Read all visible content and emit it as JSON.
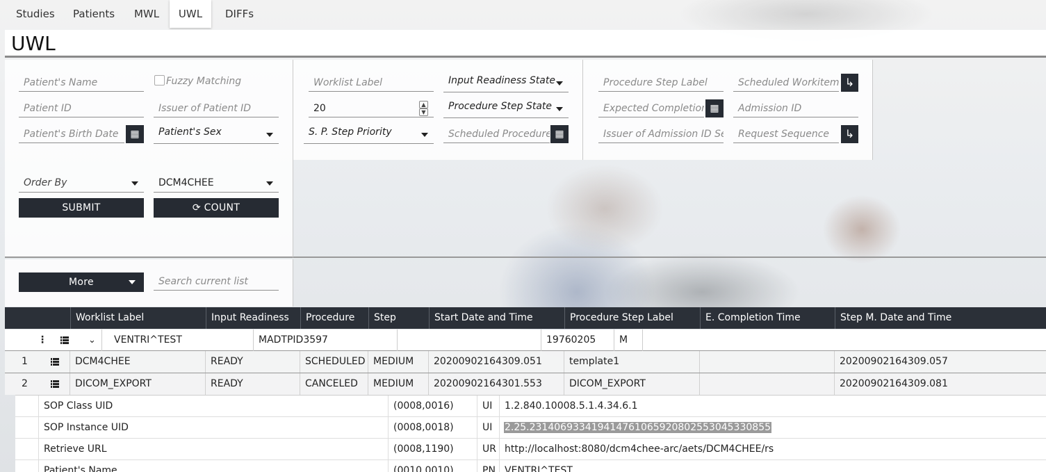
{
  "nav": {
    "tabs": [
      "Studies",
      "Patients",
      "MWL",
      "UWL",
      "DIFFs"
    ],
    "active": "UWL"
  },
  "page": {
    "title": "UWL"
  },
  "filters": {
    "patients_name": "Patient's Name",
    "fuzzy_matching": "Fuzzy Matching",
    "patient_id": "Patient ID",
    "issuer_of_patient_id": "Issuer of Patient ID",
    "patients_birth_date": "Patient's Birth Date",
    "patients_sex": "Patient's Sex",
    "worklist_label": "Worklist Label",
    "input_readiness_state": "Input Readiness State",
    "limit_value": "20",
    "procedure_step_state": "Procedure Step State",
    "sp_step_priority": "S. P. Step Priority",
    "scheduled_procedure_start": "Scheduled Procedure S",
    "procedure_step_label": "Procedure Step Label",
    "scheduled_workitem": "Scheduled Workitem",
    "expected_completion": "Expected Completion D",
    "admission_id": "Admission ID",
    "issuer_of_admission_id": "Issuer of Admission ID Sequ",
    "request_sequence": "Request Sequence",
    "order_by": "Order By",
    "aet": "DCM4CHEE",
    "submit": "SUBMIT",
    "count": "COUNT",
    "more": "More",
    "search_current_list": "Search current list"
  },
  "table": {
    "headers": [
      "Worklist Label",
      "Input Readiness",
      "Procedure",
      "Step",
      "Start Date and Time",
      "Procedure Step Label",
      "E. Completion Time",
      "Step M. Date and Time"
    ],
    "patient_row": {
      "name": "VENTRI^TEST",
      "id": "MADTPID3597",
      "birth_date": "19760205",
      "sex": "M"
    },
    "rows": [
      {
        "num": "1",
        "worklist": "DCM4CHEE",
        "readiness": "READY",
        "procedure": "SCHEDULED",
        "step": "MEDIUM",
        "start": "20200902164309.051",
        "label": "template1",
        "completion": "",
        "modified": "20200902164309.057"
      },
      {
        "num": "2",
        "worklist": "DICOM_EXPORT",
        "readiness": "READY",
        "procedure": "CANCELED",
        "step": "MEDIUM",
        "start": "20200902164301.553",
        "label": "DICOM_EXPORT",
        "completion": "",
        "modified": "20200902164309.081"
      }
    ]
  },
  "attributes": [
    {
      "name": "SOP Class UID",
      "tag": "(0008,0016)",
      "vr": "UI",
      "value": "1.2.840.10008.5.1.4.34.6.1"
    },
    {
      "name": "SOP Instance UID",
      "tag": "(0008,0018)",
      "vr": "UI",
      "value": "2.25.231406933419414761065920802553045330855"
    },
    {
      "name": "Retrieve URL",
      "tag": "(0008,1190)",
      "vr": "UR",
      "value": "http://localhost:8080/dcm4chee-arc/aets/DCM4CHEE/rs"
    },
    {
      "name": "Patient's Name",
      "tag": "(0010,0010)",
      "vr": "PN",
      "value": "VENTRI^TEST"
    }
  ]
}
